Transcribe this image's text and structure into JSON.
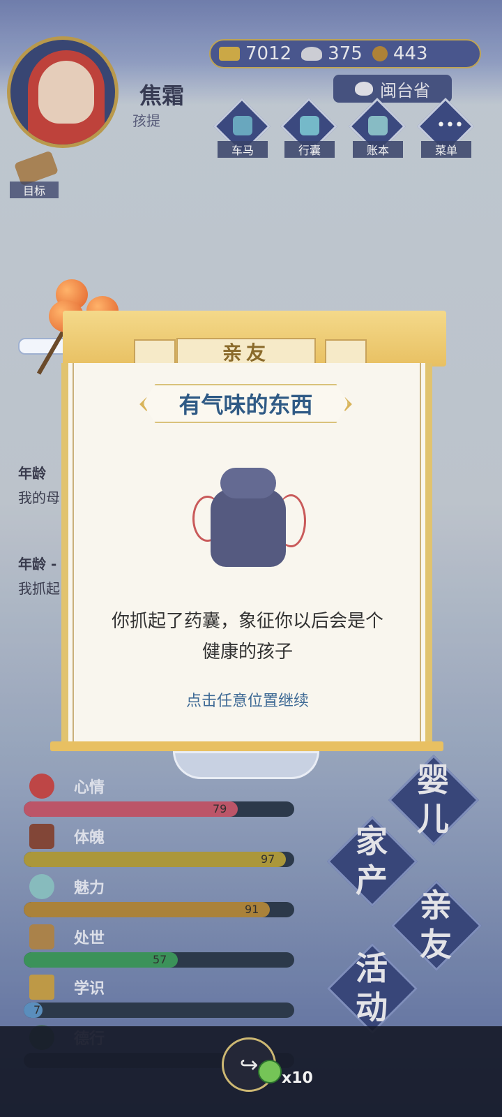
{
  "player": {
    "name": "焦霜",
    "stage": "孩提"
  },
  "goal_label": "目标",
  "currency": {
    "gold": "7012",
    "silver": "375",
    "coins": "443"
  },
  "province": "闽台省",
  "menu": [
    {
      "label": "车马",
      "icon": "carriage-icon"
    },
    {
      "label": "行囊",
      "icon": "bag-icon"
    },
    {
      "label": "账本",
      "icon": "ledger-icon"
    },
    {
      "label": "菜单",
      "icon": "more-icon"
    }
  ],
  "log": [
    {
      "age": "年龄 ",
      "text": "我的母"
    },
    {
      "age": "年龄 -",
      "text": "我抓起"
    }
  ],
  "modal": {
    "tab": "亲友",
    "title": "有气味的东西",
    "item_icon": "sachet-icon",
    "text_line1": "你抓起了药囊，象征你以后会是个",
    "text_line2": "健康的孩子",
    "continue": "点击任意位置继续"
  },
  "stats": [
    {
      "label": "心情",
      "value": "79",
      "fraction": 0.79,
      "color": "#c75a6e",
      "icon": "flower-icon"
    },
    {
      "label": "体魄",
      "value": "97",
      "fraction": 0.97,
      "color": "#b5a03e",
      "icon": "body-icon"
    },
    {
      "label": "魅力",
      "value": "91",
      "fraction": 0.91,
      "color": "#b48a3e",
      "icon": "charm-icon"
    },
    {
      "label": "处世",
      "value": "57",
      "fraction": 0.57,
      "color": "#3f9a5e",
      "icon": "world-icon"
    },
    {
      "label": "学识",
      "value": "7",
      "fraction": 0.07,
      "color": "#5f96c8",
      "icon": "books-icon"
    },
    {
      "label": "德行",
      "value": "",
      "fraction": 0.0,
      "color": "#6a3f6a",
      "icon": "virtue-icon"
    }
  ],
  "big_buttons": [
    {
      "label_top": "婴",
      "label_bottom": "儿"
    },
    {
      "label_top": "家",
      "label_bottom": "产"
    },
    {
      "label_top": "亲",
      "label_bottom": "友"
    },
    {
      "label_top": "活",
      "label_bottom": "动"
    }
  ],
  "share_count": "x10"
}
